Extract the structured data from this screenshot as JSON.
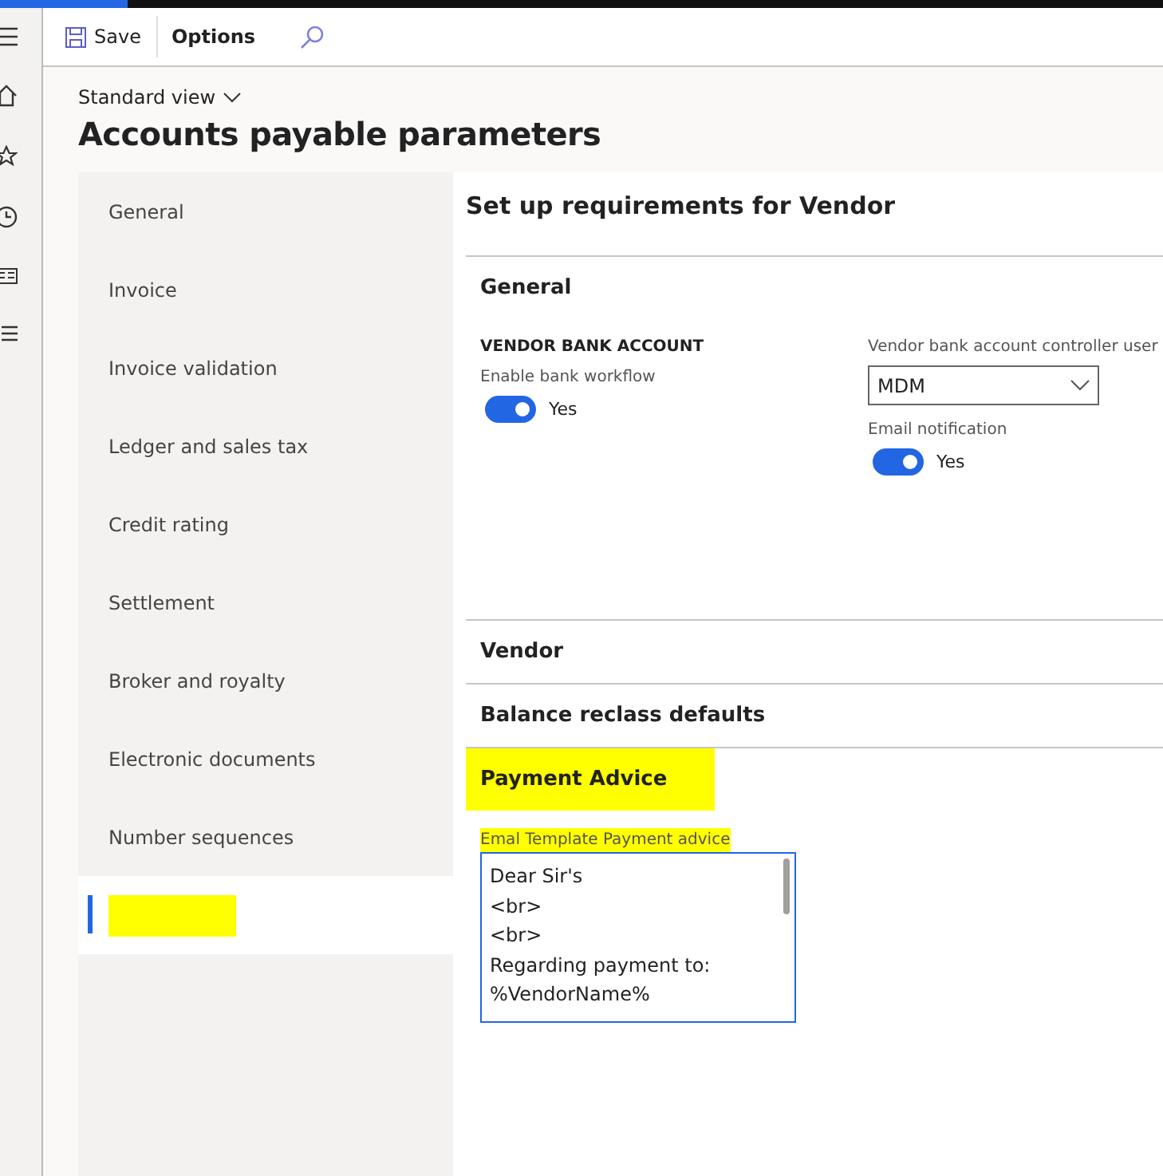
{
  "toolbar": {
    "buttons": [
      {
        "label": "Save",
        "kind": "save"
      },
      {
        "label": "Options",
        "kind": "plain"
      }
    ]
  },
  "view_selector": "Standard view",
  "page_title": "Accounts payable parameters",
  "nav": [
    {
      "label": "General",
      "selected": false
    },
    {
      "label": "Invoice",
      "selected": false
    },
    {
      "label": "Invoice validation",
      "selected": false
    },
    {
      "label": "Ledger and sales tax",
      "selected": false
    },
    {
      "label": "Credit rating",
      "selected": false
    },
    {
      "label": "Settlement",
      "selected": false
    },
    {
      "label": "Broker and royalty",
      "selected": false
    },
    {
      "label": "Electronic documents",
      "selected": false
    },
    {
      "label": "Number sequences",
      "selected": false
    },
    {
      "kind": "redacted",
      "selected": true
    }
  ],
  "content": {
    "title": "Set up requirements for Vendor",
    "sections": [
      {
        "title": "General",
        "kind": "general",
        "highlighted": false,
        "group_title": "VENDOR BANK ACCOUNT",
        "toggle_1": {
          "label": "Enable bank workflow",
          "on": true,
          "text": "Yes"
        },
        "dropdown": {
          "label": "Vendor bank account controller user",
          "value": "MDM"
        },
        "toggle_2": {
          "label": "Email notification",
          "on": true,
          "text": "Yes"
        }
      },
      {
        "title": "Vendor",
        "kind": "collapsed",
        "highlighted": false
      },
      {
        "title": "Balance reclass defaults",
        "kind": "collapsed",
        "highlighted": false
      },
      {
        "title": "Payment Advice",
        "kind": "template",
        "highlighted": true,
        "field": {
          "label": "Emal Template Payment advice",
          "label_highlighted": true,
          "lines": [
            "Dear Sir's",
            "<br>",
            "<br>",
            "Regarding payment to:",
            "%VendorName%"
          ]
        }
      }
    ]
  }
}
